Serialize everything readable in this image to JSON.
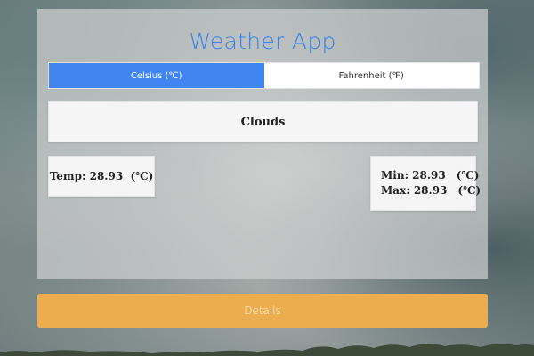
{
  "app": {
    "title": "Weather App"
  },
  "unit_toggle": {
    "celsius_label": "Celsius (℃)",
    "fahrenheit_label": "Fahrenheit (℉)",
    "selected": "celsius"
  },
  "weather": {
    "condition": "Clouds",
    "temp_label": "Temp: 28.93  (℃)",
    "min_value": "Min: 28.93",
    "max_value": "Max: 28.93",
    "min_unit": "(℃)",
    "max_unit": "(℃)"
  },
  "actions": {
    "details_label": "Details"
  },
  "colors": {
    "title": "#3b82e6",
    "toggle_active": "#4186f0",
    "details_button": "#ecad4f",
    "panel": "#cdcfce"
  },
  "background": {
    "description_icon": "cloudy-sky-image"
  }
}
